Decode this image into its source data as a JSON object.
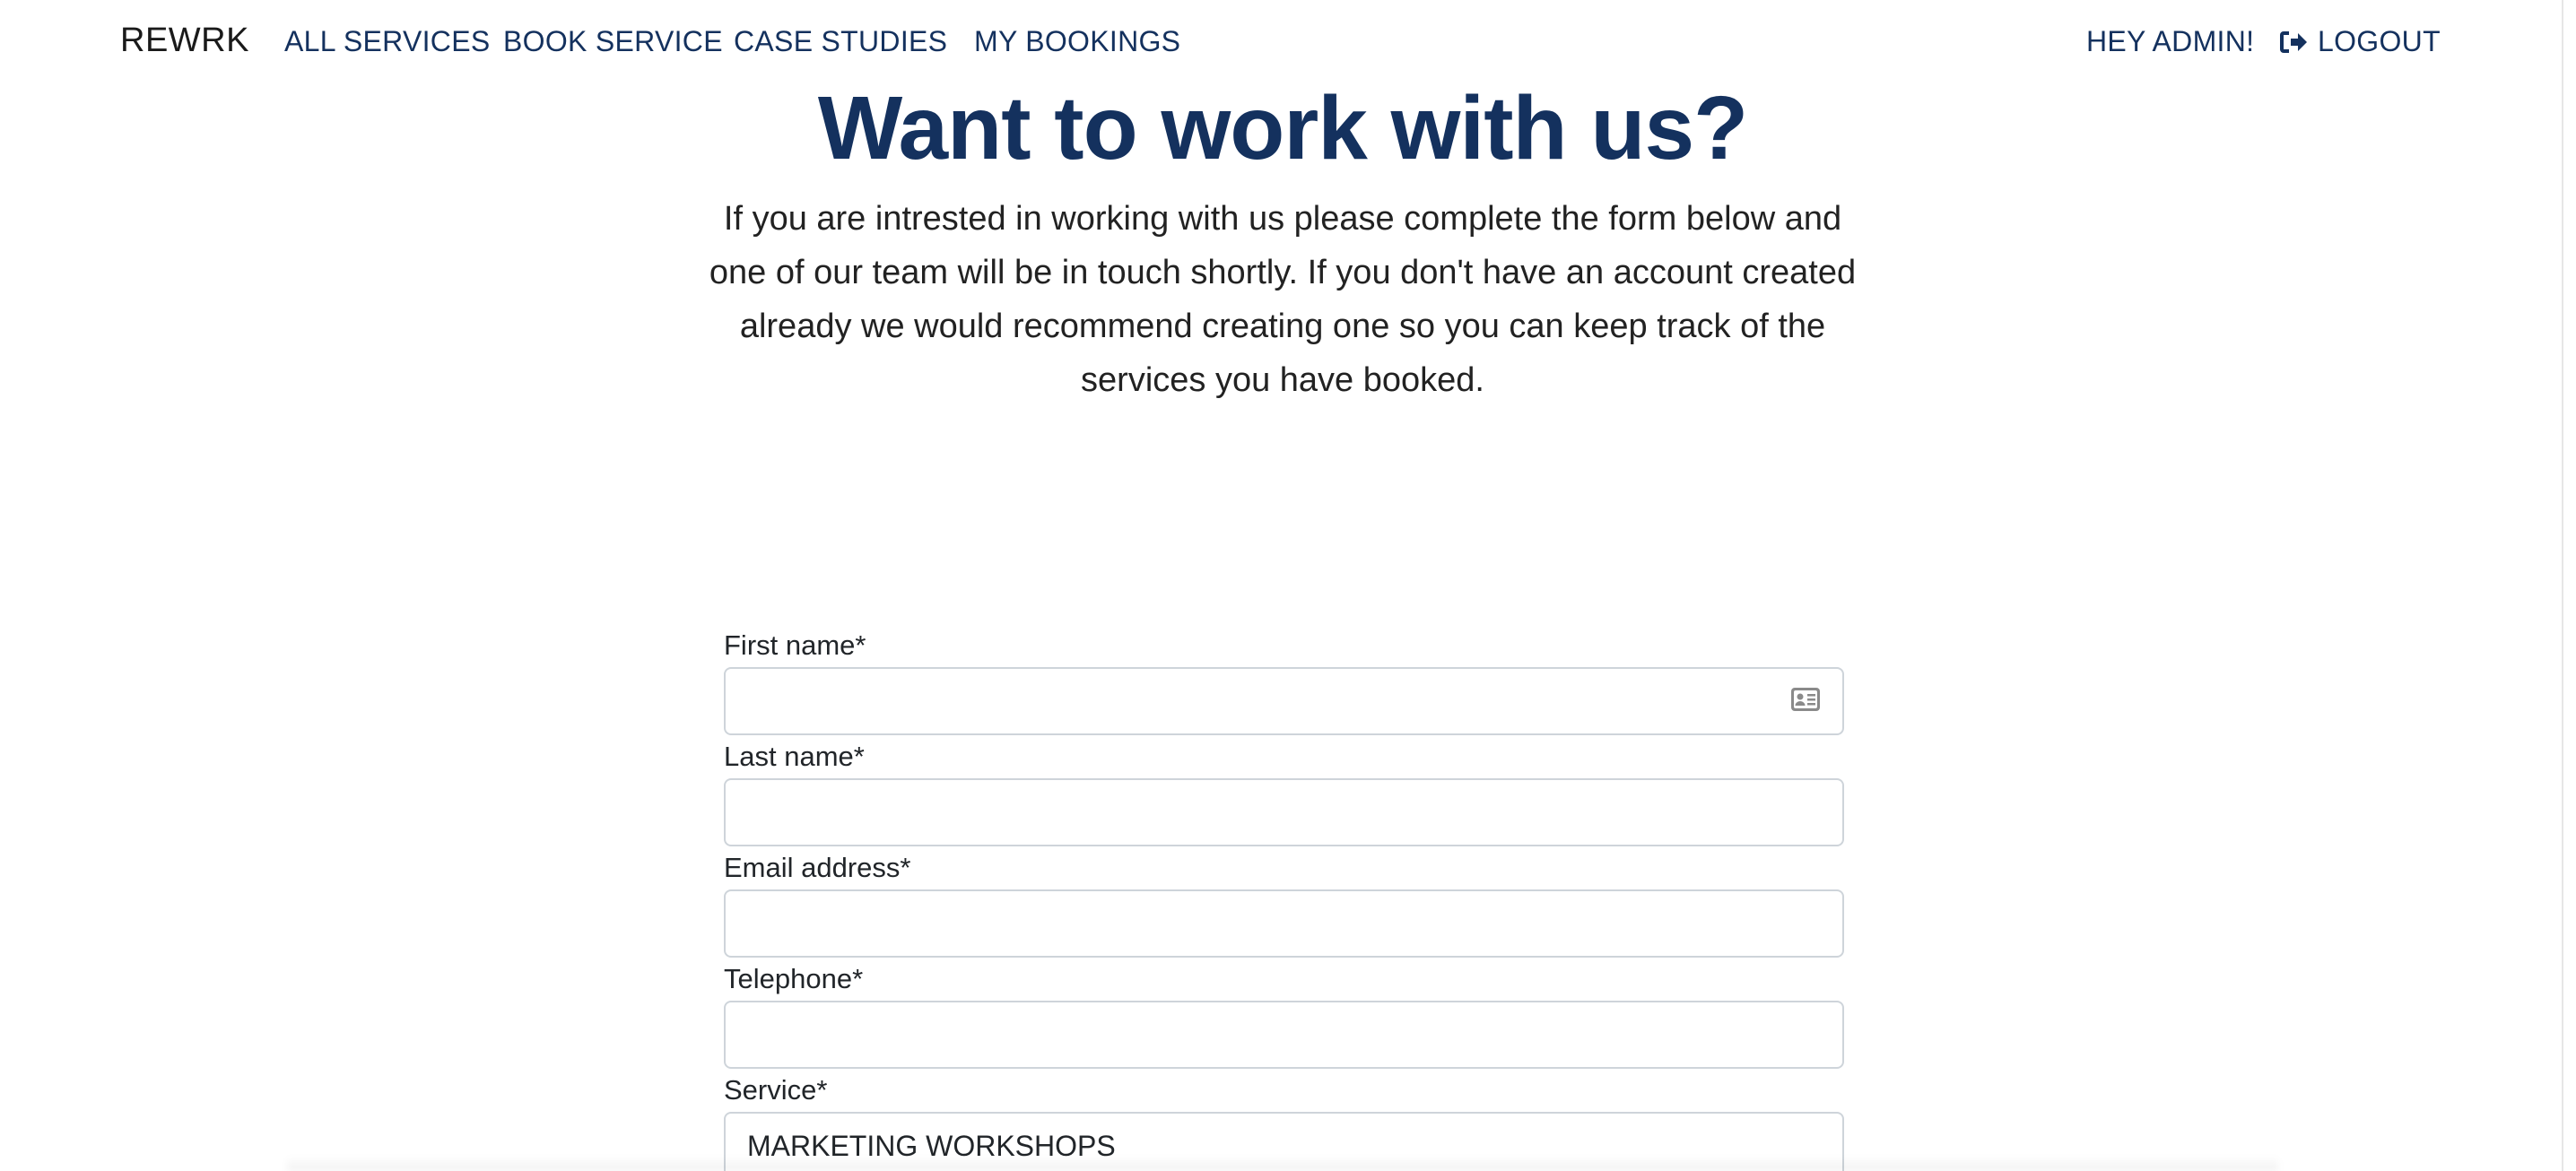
{
  "nav": {
    "brand": "REWRK",
    "links": [
      {
        "label": "ALL SERVICES"
      },
      {
        "label": "BOOK SERVICE"
      },
      {
        "label": "CASE STUDIES"
      },
      {
        "label": "MY BOOKINGS"
      }
    ],
    "greeting": "HEY ADMIN!",
    "logout_label": "LOGOUT",
    "logout_icon": "sign-out-icon"
  },
  "hero": {
    "title": "Want to work with us?",
    "text": "If you are intrested in working with us please complete the form below and one of our team will be in touch shortly. If you don't have an account created already we would recommend creating one so you can keep track of the services you have booked."
  },
  "form": {
    "first_name_label": "First name*",
    "first_name_value": "",
    "first_name_icon": "contact-card-icon",
    "last_name_label": "Last name*",
    "last_name_value": "",
    "email_label": "Email address*",
    "email_value": "",
    "telephone_label": "Telephone*",
    "telephone_value": "",
    "service_label": "Service*",
    "service_selected": "MARKETING WORKSHOPS"
  },
  "colors": {
    "brand_navy": "#14315e",
    "input_border": "#ced4da"
  }
}
